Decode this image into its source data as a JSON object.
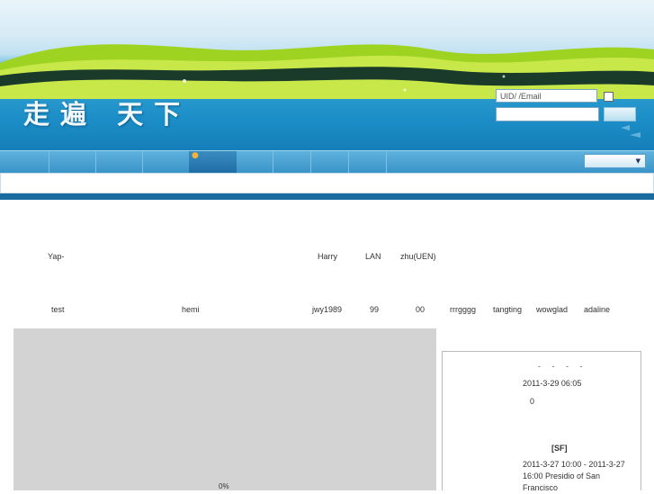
{
  "header": {
    "logo_text": "走遍 天下",
    "login": {
      "uid_placeholder": "UID/  /Email"
    }
  },
  "members": {
    "row1": [
      "Yap-",
      "Harry",
      "LAN",
      "zhu(UEN)"
    ],
    "row2": [
      "test",
      "hemi",
      "jwy1989",
      "99",
      "00",
      "rrrgggg",
      "tangting",
      "wowglad",
      "adaline"
    ]
  },
  "progress": {
    "percent_label": "0%",
    "value": 0
  },
  "events": {
    "dashes": "-     -     -     -",
    "event1_time": "2011-3-29 06:05",
    "event1_count": "0",
    "event2_tag": "[SF]",
    "event2_time": "2011-3-27 10:00 - 2011-3-27",
    "event2_place_line1": "16:00 Presidio of San",
    "event2_place_line2": "Francisco"
  },
  "colors": {
    "nav_bar": "#3a94c8",
    "active_nav": "#1f6ea6",
    "panel_gray": "#d3d3d3"
  }
}
